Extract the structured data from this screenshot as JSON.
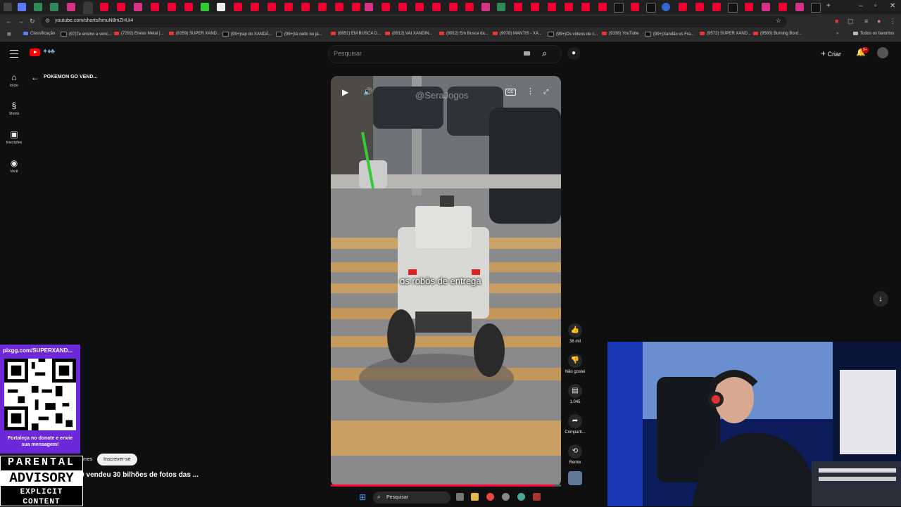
{
  "browser": {
    "url": "youtube.com/shorts/hmuN8mZHUi4",
    "bookmarks": [
      "Classificação",
      "(97)Te ensino a venc...",
      "(7292) Erelas Metal |...",
      "(8159) SUPER XAND...",
      "(99+)rap do XANDÃ...",
      "(99+)tá cedo ou já...",
      "(8851) EM BUSCA D...",
      "(8912) VAI XANDIN...",
      "(8912) Em Busca da...",
      "(9078) MANTIS - XA...",
      "(99+)Os vídeos de c...",
      "(9338) YouTube",
      "(99+)Xandão vs Fra...",
      "(9572) SUPER XAND...",
      "(9580) Burning Bord..."
    ],
    "all_bookmarks": "Todos os favoritos",
    "colors": {
      "youtube_red": "#ff0000",
      "accent_purple": "#6d28d9"
    }
  },
  "youtube": {
    "search_placeholder": "Pesquisar",
    "create_label": "Criar",
    "notification_badge": "9+",
    "nav": [
      {
        "label": "Início",
        "icon": "home-icon"
      },
      {
        "label": "Shorts",
        "icon": "shorts-icon"
      },
      {
        "label": "Inscrições",
        "icon": "subscriptions-icon"
      },
      {
        "label": "Você",
        "icon": "you-icon"
      }
    ],
    "back_label": "POKEMON GO VEND...",
    "short": {
      "watermark": "@SeraJogos",
      "caption": "os robôs de entrega",
      "likes": "36 mil",
      "dislike_label": "Não gostei",
      "comments": "1.045",
      "share_label": "Comparti...",
      "remix_label": "Remix",
      "progress": 0.97
    }
  },
  "overlay": {
    "qr_url": "pixgg.com/SUPERXAND...",
    "qr_cta": "Fortaleça no donate e envie sua mensagem!",
    "advisory_line1": "PARENTAL",
    "advisory_line2": "ADVISORY",
    "advisory_line3": "EXPLICIT CONTENT",
    "channel_fragment": "mes",
    "subscribe_label": "Inscrever-se",
    "video_title": "O vendeu 30 bilhões de fotos das ..."
  },
  "taskbar": {
    "search_label": "Pesquisar"
  }
}
